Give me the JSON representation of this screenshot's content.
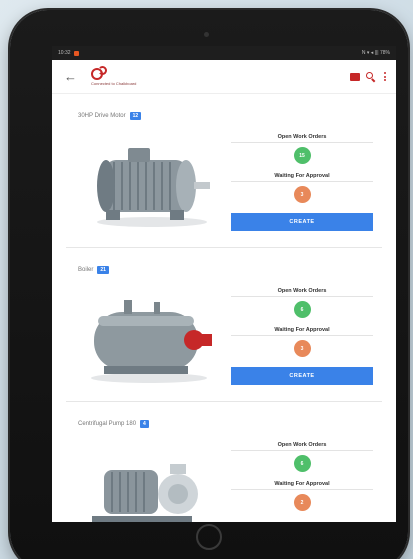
{
  "status_bar": {
    "time": "10:32",
    "right": "N ▾ ◂ ||| 78%"
  },
  "app": {
    "logo_text": "Connected to Chalkboard",
    "colors": {
      "brand": "#c62828",
      "accent": "#3a82e8",
      "green": "#4fbf6a",
      "orange": "#e8895a"
    }
  },
  "labels": {
    "open_work_orders": "Open Work Orders",
    "waiting_for_approval": "Waiting For Approval",
    "create": "CREATE"
  },
  "assets": [
    {
      "name": "30HP Drive Motor",
      "badge": "12",
      "open_work_orders": "15",
      "waiting_for_approval": "3"
    },
    {
      "name": "Boiler",
      "badge": "21",
      "open_work_orders": "6",
      "waiting_for_approval": "3"
    },
    {
      "name": "Centrifugal Pump 180",
      "badge": "4",
      "open_work_orders": "6",
      "waiting_for_approval": "2"
    }
  ]
}
